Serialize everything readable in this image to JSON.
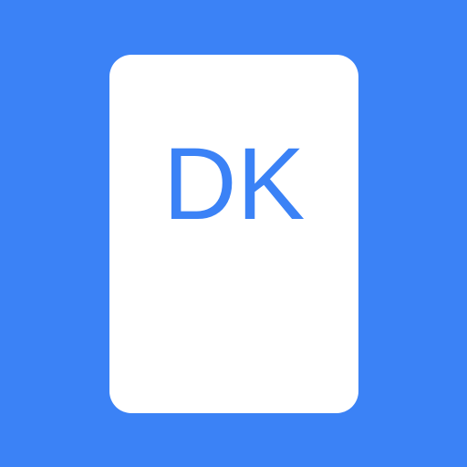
{
  "icon": {
    "label": "DK",
    "background_color": "#3b82f6",
    "card_color": "#ffffff",
    "text_color": "#3b82f6"
  }
}
